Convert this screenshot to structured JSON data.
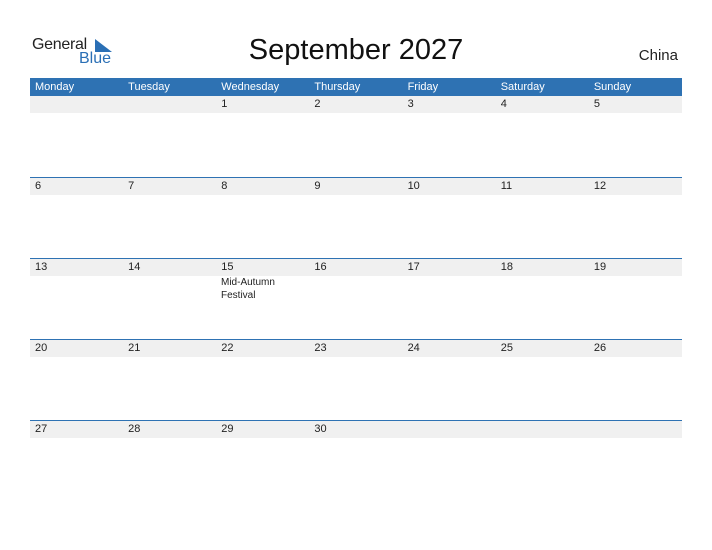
{
  "logo": {
    "general": "General",
    "blue": "Blue"
  },
  "title": "September 2027",
  "country": "China",
  "colors": {
    "accent": "#2e72b3",
    "band": "#f0f0f0"
  },
  "weekdays": [
    "Monday",
    "Tuesday",
    "Wednesday",
    "Thursday",
    "Friday",
    "Saturday",
    "Sunday"
  ],
  "weeks": [
    {
      "days": [
        "",
        "",
        "1",
        "2",
        "3",
        "4",
        "5"
      ],
      "events": [
        "",
        "",
        "",
        "",
        "",
        "",
        ""
      ]
    },
    {
      "days": [
        "6",
        "7",
        "8",
        "9",
        "10",
        "11",
        "12"
      ],
      "events": [
        "",
        "",
        "",
        "",
        "",
        "",
        ""
      ]
    },
    {
      "days": [
        "13",
        "14",
        "15",
        "16",
        "17",
        "18",
        "19"
      ],
      "events": [
        "",
        "",
        "Mid-Autumn Festival",
        "",
        "",
        "",
        ""
      ]
    },
    {
      "days": [
        "20",
        "21",
        "22",
        "23",
        "24",
        "25",
        "26"
      ],
      "events": [
        "",
        "",
        "",
        "",
        "",
        "",
        ""
      ]
    },
    {
      "days": [
        "27",
        "28",
        "29",
        "30",
        "",
        "",
        ""
      ],
      "events": [
        "",
        "",
        "",
        "",
        "",
        "",
        ""
      ]
    }
  ]
}
